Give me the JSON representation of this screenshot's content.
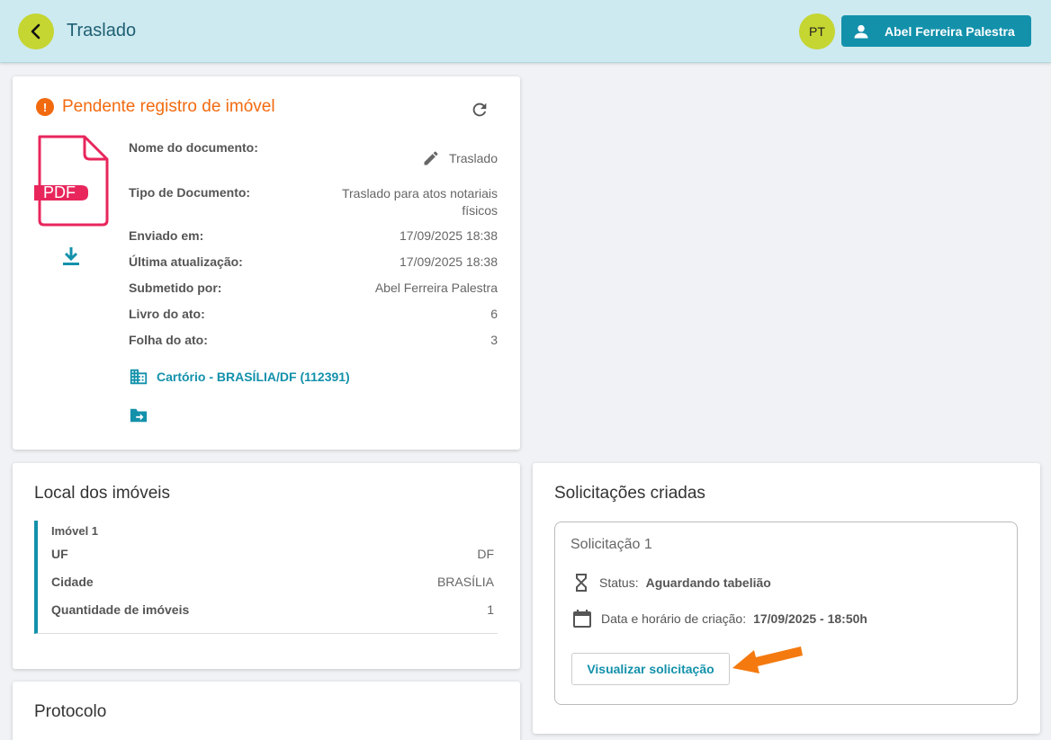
{
  "header": {
    "title": "Traslado",
    "avatar_initials": "PT",
    "user_name": "Abel Ferreira Palestra"
  },
  "document": {
    "status": "Pendente registro de imóvel",
    "pdf_label": "PDF",
    "fields": [
      {
        "label": "Nome do documento:",
        "value": "Traslado"
      },
      {
        "label": "Tipo de Documento:",
        "value": "Traslado para atos notariais físicos"
      },
      {
        "label": "Enviado em:",
        "value": "17/09/2025 18:38"
      },
      {
        "label": "Última atualização:",
        "value": "17/09/2025 18:38"
      },
      {
        "label": "Submetido por:",
        "value": "Abel Ferreira Palestra"
      },
      {
        "label": "Livro do ato:",
        "value": "6"
      },
      {
        "label": "Folha do ato:",
        "value": "3"
      }
    ],
    "cartorio": "Cartório - BRASÍLIA/DF (112391)"
  },
  "local": {
    "title": "Local dos imóveis",
    "imovel_title": "Imóvel 1",
    "rows": [
      {
        "label": "UF",
        "value": "DF"
      },
      {
        "label": "Cidade",
        "value": "BRASÍLIA"
      },
      {
        "label": "Quantidade de imóveis",
        "value": "1"
      }
    ]
  },
  "protocolo": {
    "title": "Protocolo"
  },
  "solicitacoes": {
    "title": "Solicitações criadas",
    "item_title": "Solicitação 1",
    "status_label": "Status:",
    "status_value": "Aguardando tabelião",
    "date_label": "Data e horário de criação:",
    "date_value": "17/09/2025 - 18:50h",
    "button_label": "Visualizar solicitação"
  },
  "colors": {
    "accent": "#1391ab",
    "warning": "#f26a0f",
    "header_bg": "#cdeaf0",
    "lime": "#c5d531",
    "pdf": "#e8265c"
  }
}
